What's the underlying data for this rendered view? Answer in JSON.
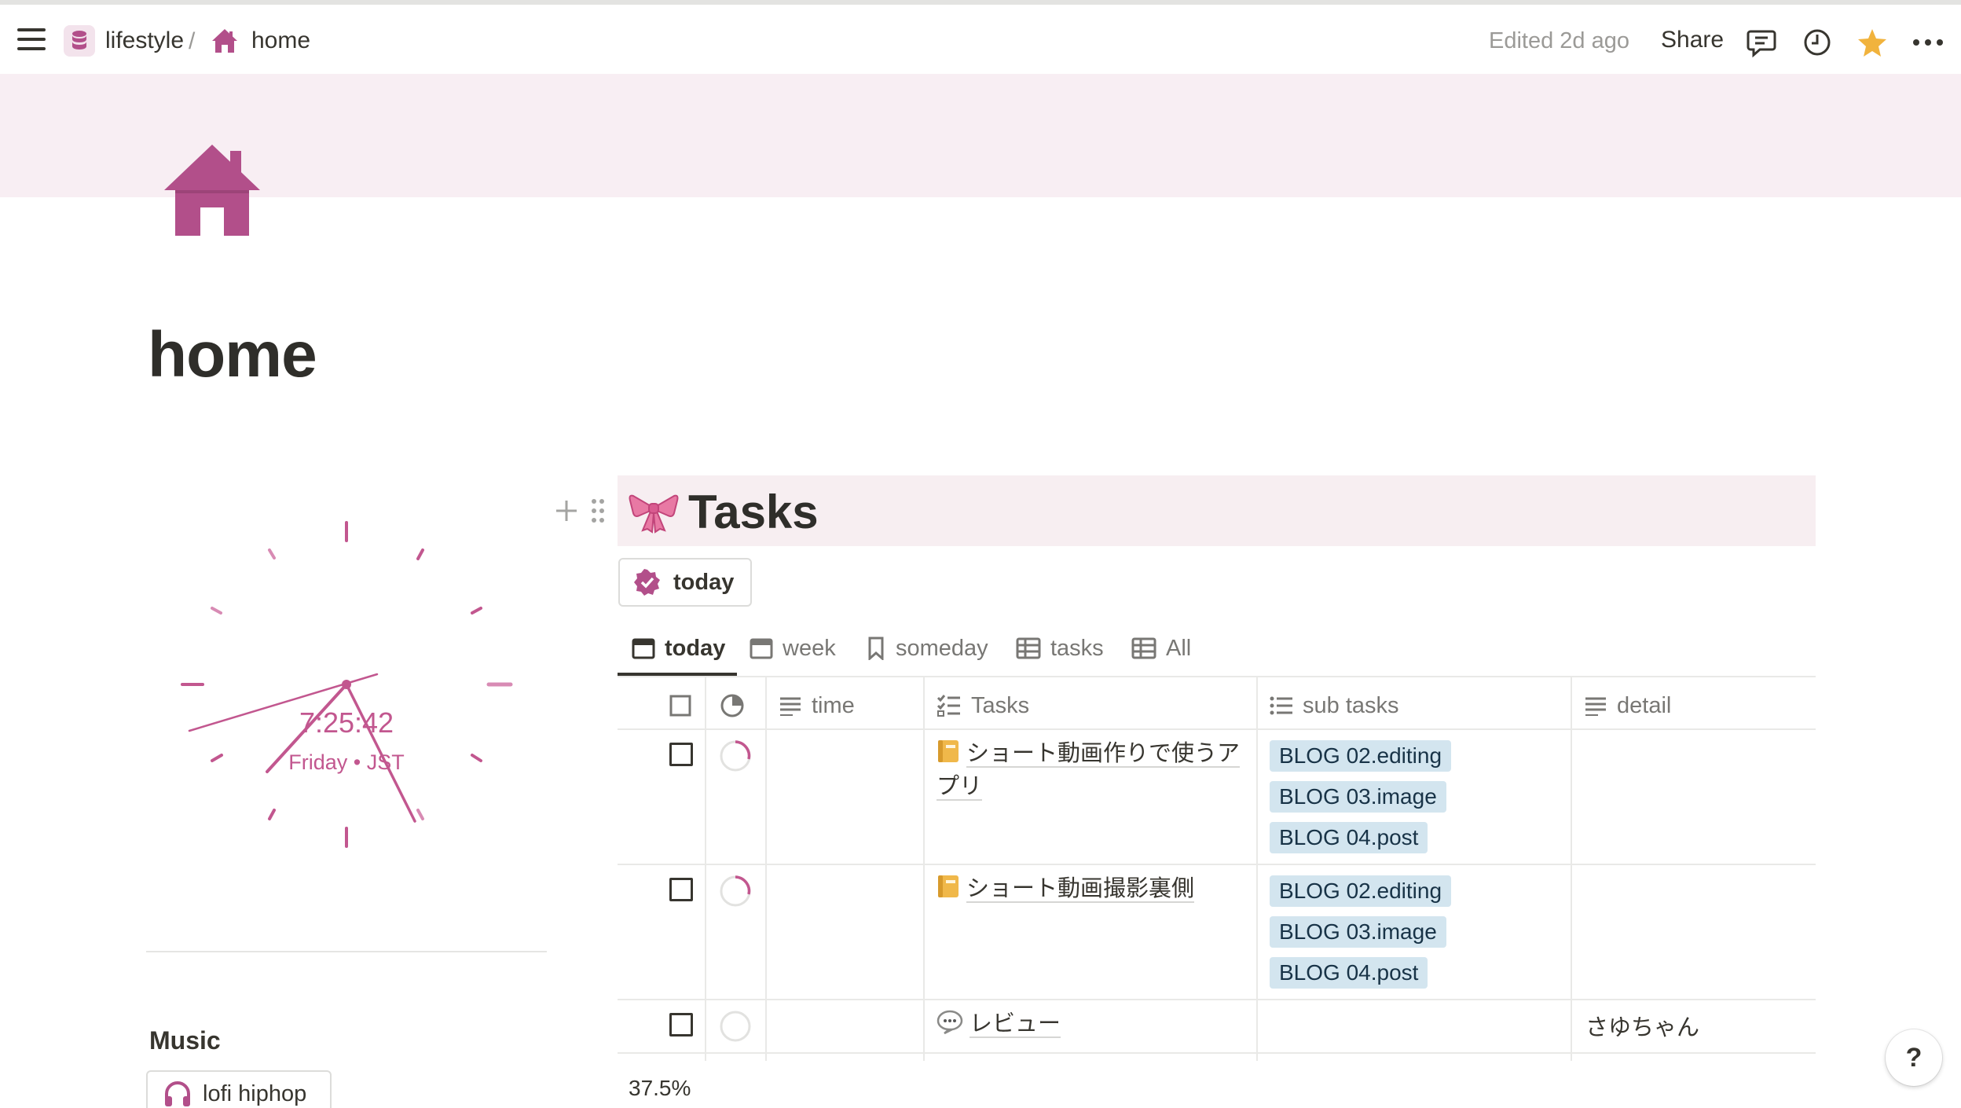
{
  "topbar": {
    "breadcrumb": [
      {
        "label": "lifestyle",
        "icon": "database-icon"
      },
      {
        "label": "home",
        "icon": "house-icon"
      }
    ],
    "separator": "/",
    "edited": "Edited 2d ago",
    "share_label": "Share",
    "actions": [
      "comments-icon",
      "clock-history-icon",
      "star-icon",
      "more-icon"
    ]
  },
  "page": {
    "title": "home",
    "icon": "house-icon",
    "accent_color": "#b24f8a",
    "cover_color": "#f8eef3"
  },
  "clock": {
    "time": "7:25:42",
    "day_zone": "Friday • JST"
  },
  "music": {
    "title": "Music",
    "button_label": "lofi hiphop",
    "button_icon": "headphones-icon"
  },
  "tasks": {
    "title": "Tasks",
    "title_icon": "ribbon-bow-icon",
    "filter_button": "today",
    "views": [
      {
        "label": "today",
        "icon": "calendar-icon",
        "active": true
      },
      {
        "label": "week",
        "icon": "calendar-icon",
        "active": false
      },
      {
        "label": "someday",
        "icon": "bookmark-icon",
        "active": false
      },
      {
        "label": "tasks",
        "icon": "table-icon",
        "active": false
      },
      {
        "label": "All",
        "icon": "table-icon",
        "active": false
      }
    ],
    "columns": [
      "time",
      "Tasks",
      "sub tasks",
      "detail"
    ],
    "rows": [
      {
        "task": "ショート動画作りで使うアプリ",
        "task_line1": "ショート動画作りで使うア",
        "task_line2": "プリ",
        "task_icon": "notebook-icon",
        "status": "in-progress",
        "sub_tasks": [
          "BLOG 02.editing",
          "BLOG 03.image",
          "BLOG 04.post"
        ],
        "detail": ""
      },
      {
        "task": "ショート動画撮影裏側",
        "task_icon": "notebook-icon",
        "status": "in-progress",
        "sub_tasks": [
          "BLOG 02.editing",
          "BLOG 03.image",
          "BLOG 04.post"
        ],
        "detail": ""
      },
      {
        "task": "レビュー",
        "task_icon": "speech-bubble-icon",
        "status": "not-started",
        "sub_tasks": [],
        "detail": "さゆちゃん"
      }
    ],
    "progress_summary": "37.5%",
    "chip_color": "#d3e5ef"
  },
  "help_label": "?"
}
